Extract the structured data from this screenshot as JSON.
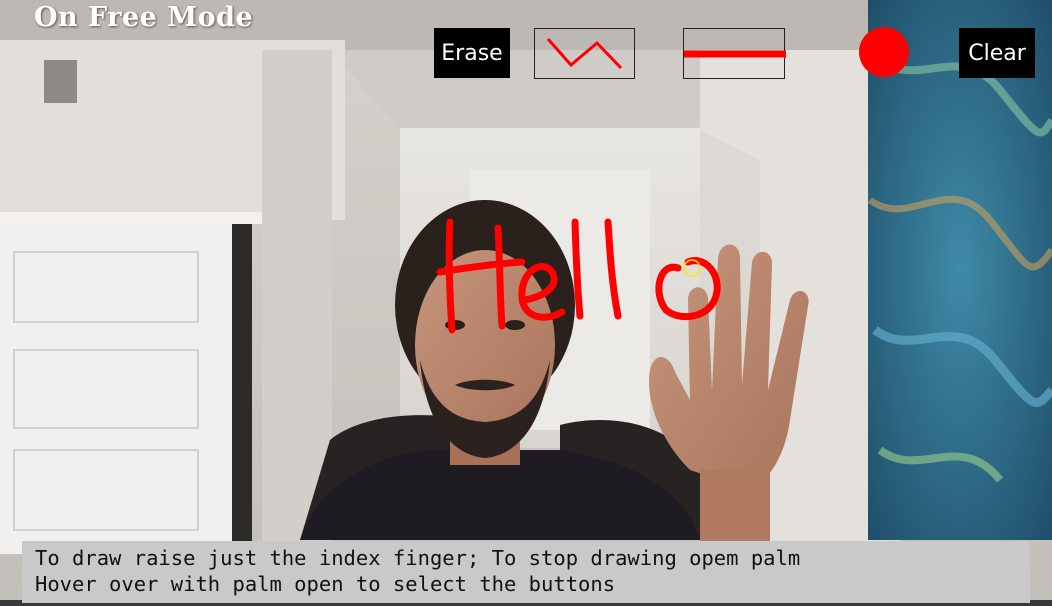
{
  "app": {
    "mode_label": "On Free Mode"
  },
  "toolbar": {
    "erase_label": "Erase",
    "clear_label": "Clear",
    "shape_icon": "zigzag-line-icon",
    "thickness_icon": "line-thickness-icon",
    "brush_color": "#ff0000"
  },
  "canvas": {
    "drawn_text": "Hello",
    "ink_color": "#ff0000",
    "cursor_color": "#ffe600"
  },
  "instructions": {
    "line1": "To draw raise just the index finger; To stop drawing opem palm",
    "line2": "Hover over with palm open to select the buttons"
  },
  "colors": {
    "button_bg": "#000000",
    "button_text": "#ffffff",
    "instruction_bar_bg": "#c9c9c9"
  }
}
